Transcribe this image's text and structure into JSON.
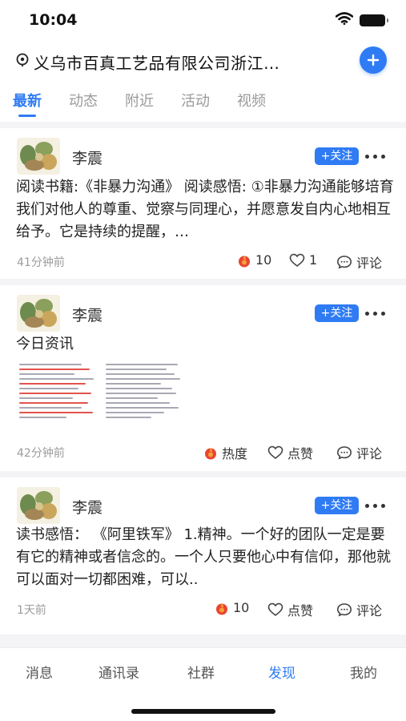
{
  "status_bar": {
    "time": "10:04",
    "wifi_icon": "wifi-icon",
    "battery_icon": "battery-icon"
  },
  "location": {
    "icon": "location-pin-icon",
    "text": "义乌市百真工艺品有限公司浙江…",
    "add_icon": "plus-icon"
  },
  "tabs": [
    {
      "label": "最新",
      "active": true
    },
    {
      "label": "动态",
      "active": false
    },
    {
      "label": "附近",
      "active": false
    },
    {
      "label": "活动",
      "active": false
    },
    {
      "label": "视频",
      "active": false
    }
  ],
  "posts": [
    {
      "author": "李震",
      "follow_label": "+关注",
      "text": "阅读书籍:《非暴力沟通》 阅读感悟: ①非暴力沟通能够培育我们对他人的尊重、觉察与同理心，并愿意发自内心地相互给予。它是持续的提醒，…",
      "time": "41分钟前",
      "heat": "10",
      "likes": "1",
      "comment": "评论"
    },
    {
      "author": "李震",
      "follow_label": "+关注",
      "text": "今日资讯",
      "time": "42分钟前",
      "heat": "热度",
      "likes": "点赞",
      "comment": "评论"
    },
    {
      "author": "李震",
      "follow_label": "+关注",
      "text": "读书感悟：  《阿里铁军》 1.精神。一个好的团队一定是要有它的精神或者信念的。一个人只要他心中有信仰，那他就可以面对一切都困难，可以..",
      "time": "1天前",
      "heat": "10",
      "likes": "点赞",
      "comment": "评论"
    }
  ],
  "bottom_nav": [
    {
      "label": "消息",
      "active": false
    },
    {
      "label": "通讯录",
      "active": false
    },
    {
      "label": "社群",
      "active": false
    },
    {
      "label": "发现",
      "active": true
    },
    {
      "label": "我的",
      "active": false
    }
  ],
  "colors": {
    "accent": "#2f7bf4",
    "heat": "#e8452f",
    "muted": "#9b9b9b",
    "separator": "#f4f4f6"
  }
}
